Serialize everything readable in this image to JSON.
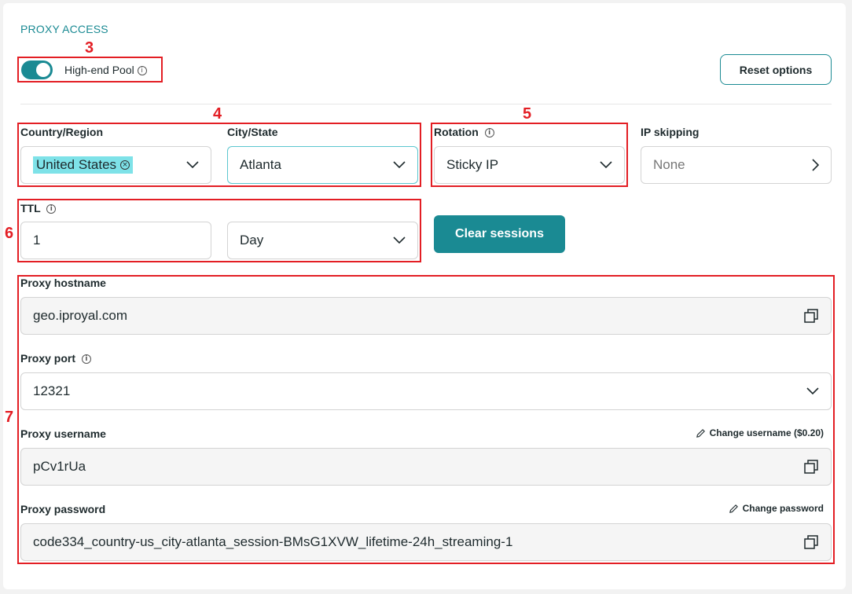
{
  "section": {
    "title": "PROXY ACCESS"
  },
  "pool": {
    "label": "High-end Pool",
    "enabled": true
  },
  "reset_button": "Reset options",
  "location": {
    "country_label": "Country/Region",
    "country_chip": "United States",
    "city_label": "City/State",
    "city_value": "Atlanta"
  },
  "rotation": {
    "label": "Rotation",
    "value": "Sticky IP"
  },
  "ip_skipping": {
    "label": "IP skipping",
    "value": "None"
  },
  "ttl": {
    "label": "TTL",
    "value": "1",
    "unit": "Day"
  },
  "clear_button": "Clear sessions",
  "hostname": {
    "label": "Proxy hostname",
    "value": "geo.iproyal.com"
  },
  "port": {
    "label": "Proxy port",
    "value": "12321"
  },
  "username": {
    "label": "Proxy username",
    "value": "pCv1rUa",
    "change_label": "Change username ($0.20)"
  },
  "password": {
    "label": "Proxy password",
    "value": "code334_country-us_city-atlanta_session-BMsG1XVW_lifetime-24h_streaming-1",
    "change_label": "Change password"
  },
  "annotations": {
    "n3": "3",
    "n4": "4",
    "n5": "5",
    "n6": "6",
    "n7": "7"
  },
  "colors": {
    "accent": "#1a8a93",
    "annotation": "#e31e24",
    "chip": "#7ee2e8"
  },
  "icons": [
    "info-icon",
    "chevron-down-icon",
    "chevron-right-icon",
    "copy-icon",
    "pencil-icon",
    "clear-chip-icon"
  ]
}
